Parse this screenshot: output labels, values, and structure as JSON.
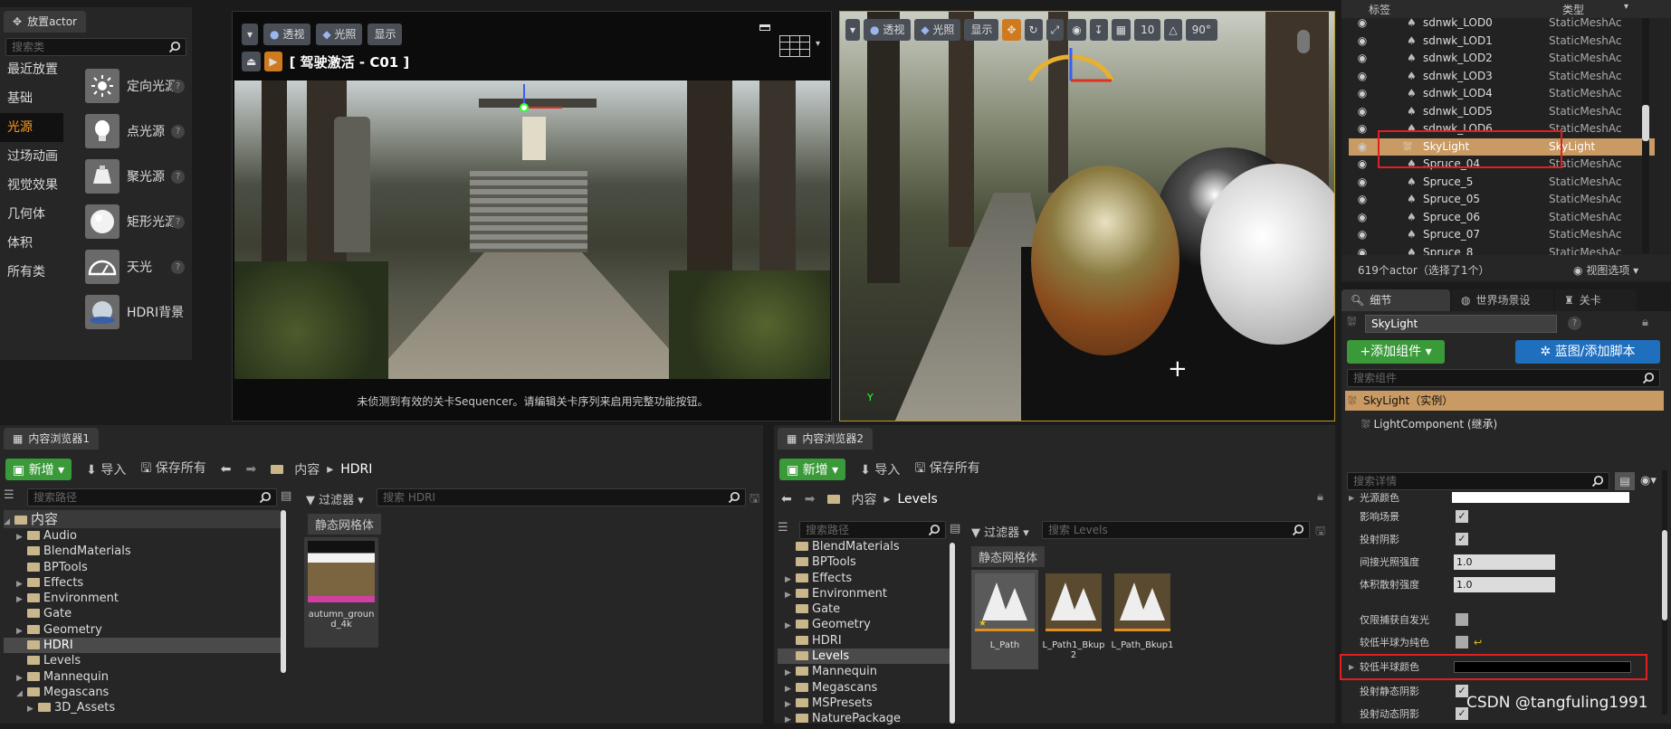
{
  "place_actor": {
    "tab_title": "放置actor",
    "search_placeholder": "搜索类",
    "categories": [
      "最近放置",
      "基础",
      "光源",
      "过场动画",
      "视觉效果",
      "几何体",
      "体积",
      "所有类"
    ],
    "active_category": "光源",
    "items": [
      {
        "label": "定向光源",
        "icon": "directional-light-icon"
      },
      {
        "label": "点光源",
        "icon": "point-light-icon"
      },
      {
        "label": "聚光源",
        "icon": "spot-light-icon"
      },
      {
        "label": "矩形光源",
        "icon": "rect-light-icon"
      },
      {
        "label": "天光",
        "icon": "sky-light-icon"
      },
      {
        "label": "HDRI背景",
        "icon": "hdri-backdrop-icon"
      }
    ]
  },
  "viewport_left": {
    "perspective_label": "透视",
    "lit_label": "光照",
    "show_label": "显示",
    "pilot_label": "[ 驾驶激活 - C01 ]",
    "sequencer_message": "未侦测到有效的关卡Sequencer。请编辑关卡序列来启用完整功能按钮。"
  },
  "viewport_right": {
    "perspective_label": "透视",
    "lit_label": "光照",
    "show_label": "显示",
    "grid_value": "10",
    "angle_value": "90°"
  },
  "outliner": {
    "col_label": "标签",
    "col_type": "类型",
    "rows": [
      {
        "name": "sdnwk_LOD0",
        "type": "StaticMeshActo"
      },
      {
        "name": "sdnwk_LOD1",
        "type": "StaticMeshActo"
      },
      {
        "name": "sdnwk_LOD2",
        "type": "StaticMeshActo"
      },
      {
        "name": "sdnwk_LOD3",
        "type": "StaticMeshActo"
      },
      {
        "name": "sdnwk_LOD4",
        "type": "StaticMeshActo"
      },
      {
        "name": "sdnwk_LOD5",
        "type": "StaticMeshActo"
      },
      {
        "name": "sdnwk_LOD6",
        "type": "StaticMeshActo"
      },
      {
        "name": "SkyLight",
        "type": "SkyLight"
      },
      {
        "name": "Spruce_04",
        "type": "StaticMeshActo"
      },
      {
        "name": "Spruce_5",
        "type": "StaticMeshActo"
      },
      {
        "name": "Spruce_05",
        "type": "StaticMeshActo"
      },
      {
        "name": "Spruce_06",
        "type": "StaticMeshActo"
      },
      {
        "name": "Spruce_07",
        "type": "StaticMeshActo"
      },
      {
        "name": "Spruce_8",
        "type": "StaticMeshActo"
      }
    ],
    "selected": "SkyLight",
    "footer_count": "619个actor（选择了1个）",
    "view_options": "视图选项"
  },
  "details": {
    "tabs": [
      "细节",
      "世界场景设",
      "关卡"
    ],
    "actor_name": "SkyLight",
    "add_component": "+添加组件",
    "blueprint_button": "蓝图/添加脚本",
    "search_components": "搜索组件",
    "instance_label": "SkyLight（实例）",
    "component_label": "LightComponent (继承)",
    "search_details": "搜索详情",
    "props": [
      {
        "label": "光源颜色",
        "kind": "color"
      },
      {
        "label": "影响场景",
        "kind": "check"
      },
      {
        "label": "投射阴影",
        "kind": "check"
      },
      {
        "label": "间接光照强度",
        "kind": "value",
        "value": "1.0"
      },
      {
        "label": "体积散射强度",
        "kind": "value",
        "value": "1.0"
      },
      {
        "label": "仅限捕获自发光",
        "kind": "uncheck"
      },
      {
        "label": "较低半球为纯色",
        "kind": "uncheck"
      },
      {
        "label": "较低半球颜色",
        "kind": "black"
      },
      {
        "label": "投射静态阴影",
        "kind": "check"
      },
      {
        "label": "投射动态阴影",
        "kind": "check"
      }
    ]
  },
  "cb1": {
    "tab_title": "内容浏览器1",
    "new_label": "新增",
    "import_label": "导入",
    "save_all_label": "保存所有",
    "breadcrumb_root": "内容",
    "breadcrumb_current": "HDRI",
    "search_path_placeholder": "搜索路径",
    "filter_label": "过滤器",
    "search_placeholder": "搜索 HDRI",
    "chip_label": "静态网格体",
    "tree_root": "内容",
    "tree": [
      "Audio",
      "BlendMaterials",
      "BPTools",
      "Effects",
      "Environment",
      "Gate",
      "Geometry",
      "HDRI",
      "Levels",
      "Mannequin",
      "Megascans",
      "3D_Assets"
    ],
    "tree_selected": "HDRI",
    "asset_name": "autumn_ground_4k"
  },
  "cb2": {
    "tab_title": "内容浏览器2",
    "new_label": "新增",
    "import_label": "导入",
    "save_all_label": "保存所有",
    "breadcrumb_root": "内容",
    "breadcrumb_current": "Levels",
    "search_path_placeholder": "搜索路径",
    "filter_label": "过滤器",
    "search_placeholder": "搜索 Levels",
    "chip_label": "静态网格体",
    "tree": [
      "BlendMaterials",
      "BPTools",
      "Effects",
      "Environment",
      "Gate",
      "Geometry",
      "HDRI",
      "Levels",
      "Mannequin",
      "Megascans",
      "MSPresets",
      "NaturePackage"
    ],
    "tree_selected": "Levels",
    "assets": [
      "L_Path",
      "L_Path1_Bkup2",
      "L_Path_Bkup1"
    ]
  },
  "watermark": "CSDN @tangfuling1991",
  "colors": {
    "accent": "#ff9d1a",
    "selection": "#c99a63",
    "highlight_red": "#e02020",
    "green": "#3a9a3a",
    "blue": "#1f6fbf"
  }
}
